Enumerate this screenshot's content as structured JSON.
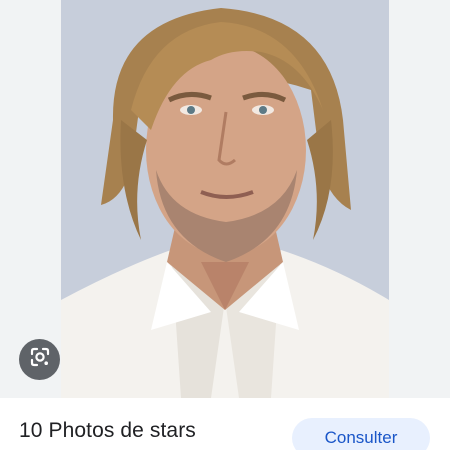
{
  "image_panel": {
    "photo_icon": "person-portrait",
    "lens_icon": "google-lens-icon",
    "background_color": "#f1f3f4"
  },
  "footer": {
    "source_title": "10 Photos de stars",
    "visit_button_label": "Consulter",
    "accent_color": "#1a56c8"
  }
}
